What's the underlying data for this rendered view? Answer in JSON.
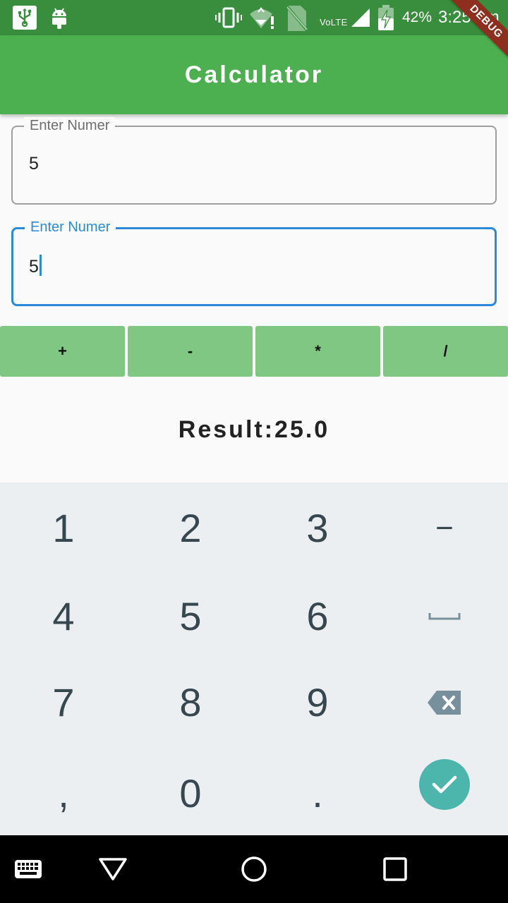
{
  "status_bar": {
    "network_label": "VoLTE",
    "battery_percent": "42%",
    "time": "3:25 pm"
  },
  "debug_banner": "DEBUG",
  "app_bar": {
    "title": "Calculator"
  },
  "fields": [
    {
      "label": "Enter Numer",
      "value": "5"
    },
    {
      "label": "Enter Numer",
      "value": "5"
    }
  ],
  "operators": [
    "+",
    "-",
    "*",
    "/"
  ],
  "result_text": "Result:25.0",
  "keyboard": {
    "rows": [
      [
        "1",
        "2",
        "3",
        "−"
      ],
      [
        "4",
        "5",
        "6",
        "space-icon"
      ],
      [
        "7",
        "8",
        "9",
        "backspace-icon"
      ],
      [
        ",",
        "0",
        ".",
        "done-icon"
      ]
    ],
    "accent_color": "#4db6ac"
  },
  "colors": {
    "app_bar": "#4caf50",
    "status_bar": "#388e3c",
    "operator_button": "#81c784",
    "focus": "#2a8ad9"
  },
  "nav_bar": [
    "keyboard-switch-icon",
    "back-icon",
    "home-icon",
    "recents-icon"
  ]
}
